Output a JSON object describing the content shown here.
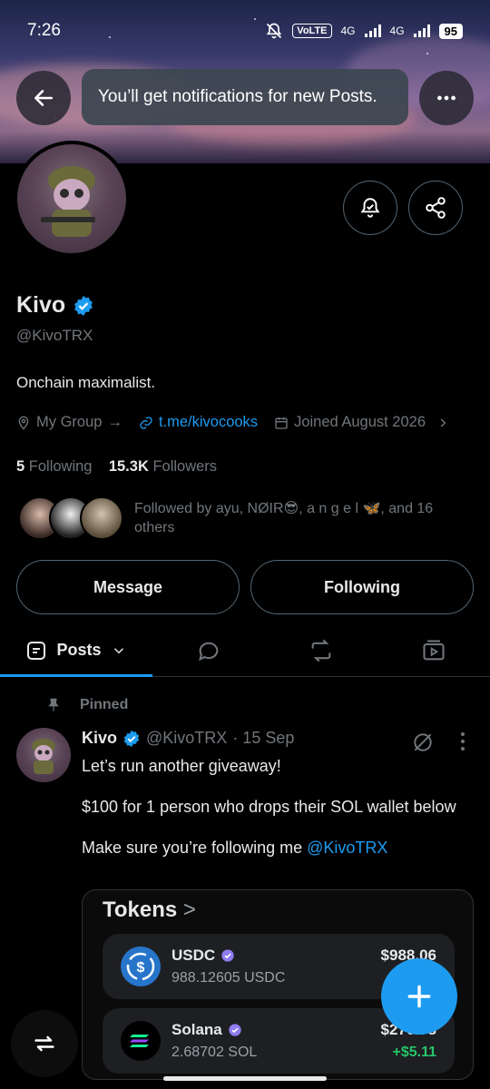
{
  "status_bar": {
    "time": "7:26",
    "volte": "VoLTE",
    "net1": "4G",
    "net2": "4G",
    "battery": "95"
  },
  "toast": {
    "text": "You’ll get notifications for new Posts."
  },
  "profile": {
    "name": "Kivo",
    "handle": "@KivoTRX",
    "bio": "Onchain maximalist.",
    "location": "My Group",
    "location_arrow": "→",
    "link": "t.me/kivocooks",
    "joined": "Joined August 2026",
    "following_count": "5",
    "following_label": "Following",
    "followers_count": "15.3K",
    "followers_label": "Followers",
    "followed_by": "Followed by ayu, NØIR😎, a n g e l 🦋, and 16 others"
  },
  "actions": {
    "message": "Message",
    "following": "Following"
  },
  "tabs": {
    "posts": "Posts"
  },
  "post": {
    "pinned_label": "Pinned",
    "author": "Kivo",
    "handle": "@KivoTRX",
    "date": "· 15 Sep",
    "line1": "Let’s run another giveaway!",
    "line2": "$100 for 1 person who drops their SOL wallet below",
    "line3": "Make sure you’re following me",
    "mention": "@KivoTRX"
  },
  "card": {
    "title": "Tokens",
    "title_chevron": ">",
    "tokens": [
      {
        "name": "USDC",
        "amount": "988.12605 USDC",
        "value": "$988.06",
        "change": ""
      },
      {
        "name": "Solana",
        "amount": "2.68702 SOL",
        "value": "$270.78",
        "change": "+$5.11"
      }
    ]
  },
  "colors": {
    "accent": "#1d9bf0",
    "positive": "#26c56b",
    "muted": "#71767b"
  }
}
